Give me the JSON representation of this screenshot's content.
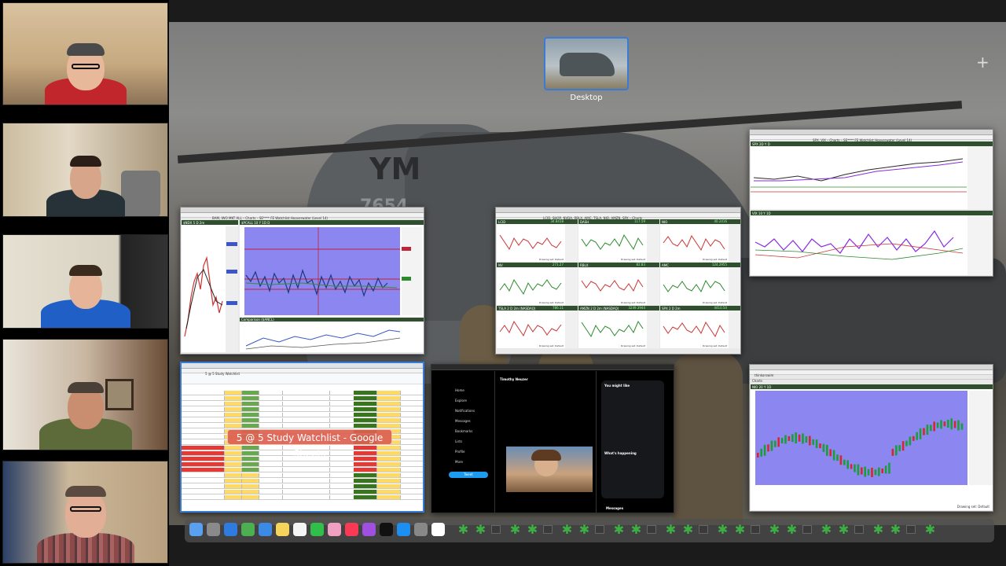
{
  "participants": [
    {
      "name": "participant-1",
      "shirt": "#c0262c",
      "wall": "#cdb08a"
    },
    {
      "name": "participant-2",
      "shirt": "#263238",
      "wall": "#b7a889"
    },
    {
      "name": "participant-3",
      "shirt": "#1f5fc6",
      "wall": "#d8d2c2"
    },
    {
      "name": "participant-4",
      "shirt": "#5d6b3a",
      "wall": "#c9b7a2"
    },
    {
      "name": "participant-5",
      "shirt": "#8b4a48",
      "wall": "#cbb89a"
    }
  ],
  "mission_control": {
    "desktop_label": "Desktop",
    "add_space": "+"
  },
  "wallpaper": {
    "hull_text": "YM",
    "hull_number": "7654"
  },
  "windows": {
    "bam_chart": {
      "title": "BAM, IWO MKT ALL – Charts – SE**** FE Watchlist Hooverwater (Level 14)",
      "tab": "Charts",
      "left_symbol": "$NDX 5 D 2m",
      "main_symbol": "$PCALL 10 Y 1D D",
      "sub_label": "Comparison ($ANCL)"
    },
    "multi_chart": {
      "title": "LCID, SHOP, NVDA, RBLX, AMC, TSLA, NIO, AMZN, SPX – Charts",
      "tab": "Charts",
      "panes": [
        {
          "symbol": "LCID",
          "price": "34.8418"
        },
        {
          "symbol": "DASH",
          "price": "117.59"
        },
        {
          "symbol": "NIO",
          "price": "40.2416"
        },
        {
          "symbol": "NV",
          "price": "271.27"
        },
        {
          "symbol": "RBLX",
          "price": "82.83"
        },
        {
          "symbol": "AMC",
          "price": "124.2955"
        },
        {
          "symbol": "TSLA 2 D 2m (NASDAQ)",
          "price": "786.11"
        },
        {
          "symbol": "AMZN 2 D 2m (NASDAQ)",
          "price": "3249.3944"
        },
        {
          "symbol": "SPX 2 D 2m",
          "price": "4410.50"
        }
      ],
      "footer": "Drawing set: Default"
    },
    "spx_chart": {
      "title": "SPX, VIX – Charts – SE**** FE Watchlist Hooverwater (Level 14)",
      "tab": "Charts",
      "top_symbol": "SPX 2D Y D",
      "bottom_symbol": "VIX 10 Y 1D"
    },
    "sheets": {
      "title": "5 @ 5 Study Watchlist",
      "label": "5 @ 5 Study Watchlist - Google Sheets"
    },
    "twitter": {
      "nav": [
        "Home",
        "Explore",
        "Notifications",
        "Messages",
        "Bookmarks",
        "Lists",
        "Profile",
        "More"
      ],
      "tweet_button": "Tweet",
      "author": "Timothy Neuzer",
      "might_like": "You might like",
      "happening": "What's happening",
      "messages": "Messages"
    },
    "nio_chart": {
      "title": "thinkorswim",
      "tab": "Charts",
      "symbol": "NIO 20 Y 1D",
      "footer": "Drawing set: Default"
    }
  },
  "dock": {
    "apps": [
      "finder",
      "launchpad",
      "safari",
      "chrome",
      "mail",
      "notes",
      "reminders",
      "facetime",
      "photos",
      "music",
      "podcasts",
      "tv",
      "appstore",
      "settings",
      "calendar"
    ]
  },
  "colors": {
    "accent": "#3a7bd5",
    "sheet_highlight": "#dd604f",
    "dock_leaf": "#3cb043"
  }
}
